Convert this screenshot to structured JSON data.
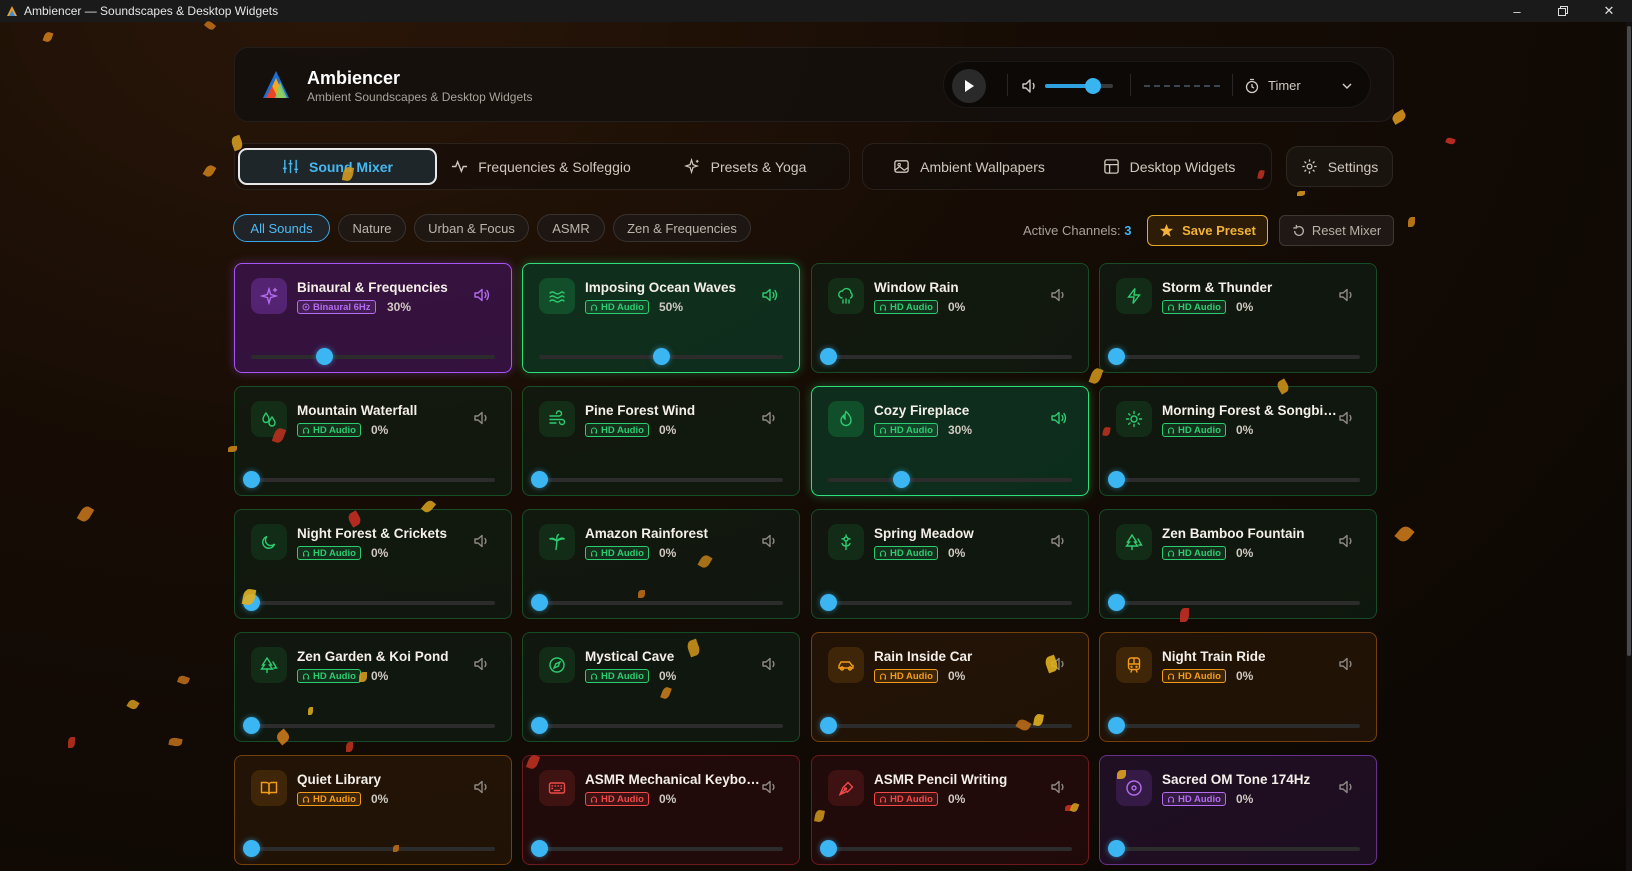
{
  "window": {
    "title": "Ambiencer — Soundscapes & Desktop Widgets"
  },
  "header": {
    "brand_name": "Ambiencer",
    "brand_sub": "Ambient Soundscapes & Desktop Widgets",
    "volume_level": 0.7,
    "timer_label": "Timer"
  },
  "tabs_left": [
    {
      "label": "Sound Mixer",
      "icon": "sliders-icon",
      "active": true
    },
    {
      "label": "Frequencies & Solfeggio",
      "icon": "pulse-icon"
    },
    {
      "label": "Presets & Yoga",
      "icon": "sparkles-icon"
    }
  ],
  "tabs_right": [
    {
      "label": "Ambient Wallpapers",
      "icon": "image-icon"
    },
    {
      "label": "Desktop Widgets",
      "icon": "layout-icon"
    }
  ],
  "settings_label": "Settings",
  "filters": [
    "All Sounds",
    "Nature",
    "Urban & Focus",
    "ASMR",
    "Zen & Frequencies"
  ],
  "active_filter": "All Sounds",
  "active_channels_label": "Active Channels:",
  "active_channels_count": "3",
  "save_preset_label": "Save Preset",
  "reset_mixer_label": "Reset Mixer",
  "colors": {
    "accent": "#3cb6f2",
    "green": "#22c55e",
    "orange": "#f59e0b",
    "red": "#ef4444",
    "purple": "#a855f7"
  },
  "sounds": [
    {
      "name": "Binaural & Frequencies",
      "badge": "Binaural 6Hz",
      "volume": "30%",
      "level": 0.3,
      "theme": "purple",
      "icon": "sparkles-icon",
      "selected": true
    },
    {
      "name": "Imposing Ocean Waves",
      "badge": "HD Audio",
      "volume": "50%",
      "level": 0.5,
      "theme": "green",
      "icon": "waves-icon",
      "selected": true
    },
    {
      "name": "Window Rain",
      "badge": "HD Audio",
      "volume": "0%",
      "level": 0,
      "theme": "green",
      "icon": "cloud-rain-icon"
    },
    {
      "name": "Storm & Thunder",
      "badge": "HD Audio",
      "volume": "0%",
      "level": 0,
      "theme": "green",
      "icon": "lightning-icon"
    },
    {
      "name": "Mountain Waterfall",
      "badge": "HD Audio",
      "volume": "0%",
      "level": 0,
      "theme": "green",
      "icon": "droplets-icon"
    },
    {
      "name": "Pine Forest Wind",
      "badge": "HD Audio",
      "volume": "0%",
      "level": 0,
      "theme": "green",
      "icon": "wind-icon"
    },
    {
      "name": "Cozy Fireplace",
      "badge": "HD Audio",
      "volume": "30%",
      "level": 0.3,
      "theme": "green",
      "icon": "flame-icon",
      "selected": true
    },
    {
      "name": "Morning Forest & Songbirds",
      "badge": "HD Audio",
      "volume": "0%",
      "level": 0,
      "theme": "green",
      "icon": "sun-icon"
    },
    {
      "name": "Night Forest & Crickets",
      "badge": "HD Audio",
      "volume": "0%",
      "level": 0,
      "theme": "green",
      "icon": "moon-icon"
    },
    {
      "name": "Amazon Rainforest",
      "badge": "HD Audio",
      "volume": "0%",
      "level": 0,
      "theme": "green",
      "icon": "palm-tree-icon"
    },
    {
      "name": "Spring Meadow",
      "badge": "HD Audio",
      "volume": "0%",
      "level": 0,
      "theme": "green",
      "icon": "flower-icon"
    },
    {
      "name": "Zen Bamboo Fountain",
      "badge": "HD Audio",
      "volume": "0%",
      "level": 0,
      "theme": "green",
      "icon": "trees-icon"
    },
    {
      "name": "Zen Garden & Koi Pond",
      "badge": "HD Audio",
      "volume": "0%",
      "level": 0,
      "theme": "green",
      "icon": "trees-icon"
    },
    {
      "name": "Mystical Cave",
      "badge": "HD Audio",
      "volume": "0%",
      "level": 0,
      "theme": "green",
      "icon": "compass-icon"
    },
    {
      "name": "Rain Inside Car",
      "badge": "HD Audio",
      "volume": "0%",
      "level": 0,
      "theme": "orange",
      "icon": "car-icon"
    },
    {
      "name": "Night Train Ride",
      "badge": "HD Audio",
      "volume": "0%",
      "level": 0,
      "theme": "orange",
      "icon": "train-icon"
    },
    {
      "name": "Quiet Library",
      "badge": "HD Audio",
      "volume": "0%",
      "level": 0,
      "theme": "orange",
      "icon": "book-icon"
    },
    {
      "name": "ASMR Mechanical Keyboard",
      "badge": "HD Audio",
      "volume": "0%",
      "level": 0,
      "theme": "red",
      "icon": "keyboard-icon"
    },
    {
      "name": "ASMR Pencil Writing",
      "badge": "HD Audio",
      "volume": "0%",
      "level": 0,
      "theme": "red",
      "icon": "pen-tool-icon"
    },
    {
      "name": "Sacred OM Tone 174Hz",
      "badge": "HD Audio",
      "volume": "0%",
      "level": 0,
      "theme": "purple",
      "icon": "disc-icon"
    }
  ]
}
